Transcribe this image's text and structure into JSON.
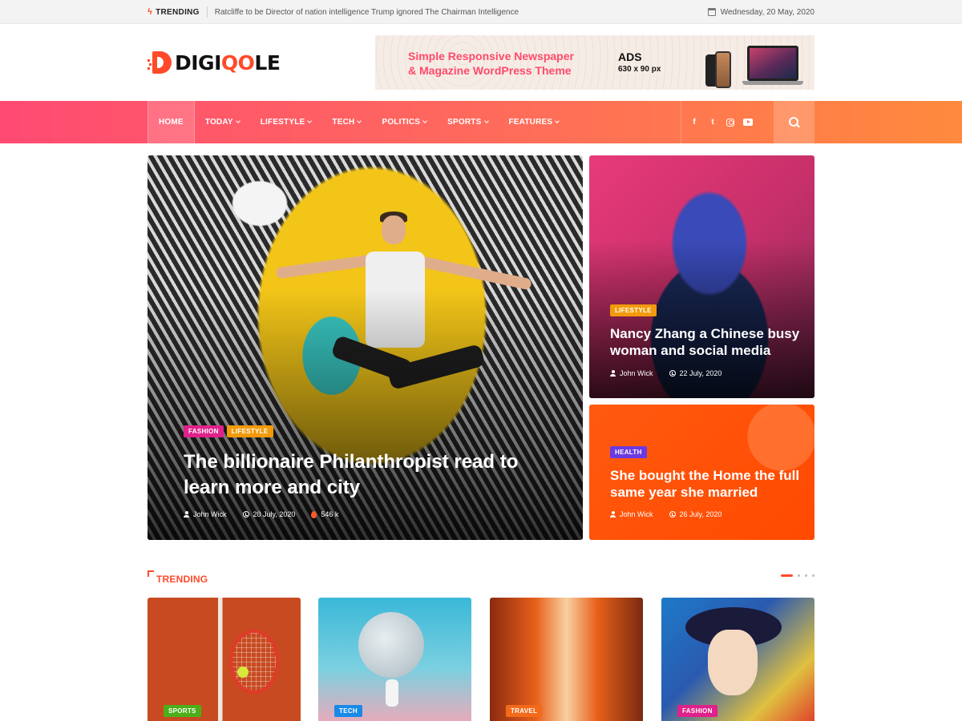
{
  "topbar": {
    "trending_label": "TRENDING",
    "trending_text": "Ratcliffe to be Director of nation intelligence Trump ignored The Chairman Intelligence",
    "date": "Wednesday, 20 May, 2020"
  },
  "logo": {
    "prefix": "DIGI",
    "accent": "QO",
    "suffix": "LE",
    "accent_color": "#ff4a2a"
  },
  "ad": {
    "title": "Simple Responsive Newspaper & Magazine WordPress Theme",
    "label": "ADS",
    "size": "630 x 90 px"
  },
  "nav": {
    "items": [
      {
        "label": "HOME",
        "dropdown": false,
        "active": true
      },
      {
        "label": "TODAY",
        "dropdown": true
      },
      {
        "label": "LIFESTYLE",
        "dropdown": true
      },
      {
        "label": "TECH",
        "dropdown": true
      },
      {
        "label": "POLITICS",
        "dropdown": true
      },
      {
        "label": "SPORTS",
        "dropdown": true
      },
      {
        "label": "FEATURES",
        "dropdown": true
      }
    ],
    "social": [
      "facebook-icon",
      "twitter-icon",
      "instagram-icon",
      "youtube-icon"
    ],
    "facebook_glyph": "f",
    "twitter_glyph": "t"
  },
  "featured": {
    "main": {
      "categories": [
        {
          "label": "FASHION",
          "color": "#e0218a"
        },
        {
          "label": "LIFESTYLE",
          "color": "#f29a0a"
        }
      ],
      "title": "The billionaire Philanthropist read to learn more and city",
      "author": "John Wick",
      "date": "20 July, 2020",
      "views": "546 k"
    },
    "side": [
      {
        "category": {
          "label": "LIFESTYLE",
          "color": "#f29a0a"
        },
        "title": "Nancy Zhang a Chinese busy woman and social media",
        "author": "John Wick",
        "date": "22 July, 2020"
      },
      {
        "category": {
          "label": "HEALTH",
          "color": "#6a3ae0"
        },
        "title": "She bought the Home the full same year she married",
        "author": "John Wick",
        "date": "26 July, 2020"
      }
    ]
  },
  "trending": {
    "title": "TRENDING",
    "cards": [
      {
        "category": "SPORTS",
        "color": "#4caf1a"
      },
      {
        "category": "TECH",
        "color": "#1a8ae8"
      },
      {
        "category": "TRAVEL",
        "color": "#f26a1a"
      },
      {
        "category": "FASHION",
        "color": "#e0218a"
      }
    ]
  }
}
